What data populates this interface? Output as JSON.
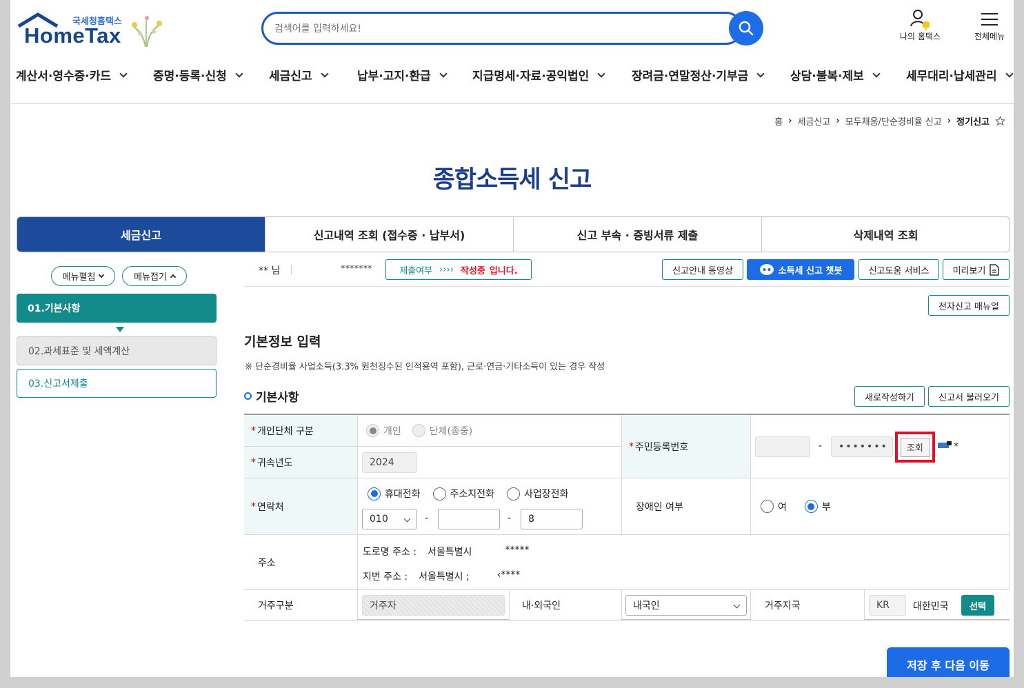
{
  "header": {
    "logo_sub": "국세청홈택스",
    "logo_brand": "HomeTax",
    "search_placeholder": "검색어를 입력하세요!",
    "my_hometax": "나의 홈택스",
    "all_menu": "전체메뉴"
  },
  "gnb": [
    "계산서·영수증·카드",
    "증명·등록·신청",
    "세금신고",
    "납부·고지·환급",
    "지급명세·자료·공익법인",
    "장려금·연말정산·기부금",
    "상담·불복·제보",
    "세무대리·납세관리"
  ],
  "breadcrumb": {
    "home": "홈",
    "c1": "세금신고",
    "c2": "모두채움/단순경비율 신고",
    "current": "정기신고"
  },
  "page_title": "종합소득세 신고",
  "tabs": [
    "세금신고",
    "신고내역 조회 (접수증 · 납부서)",
    "신고 부속 · 증빙서류 제출",
    "삭제내역 조회"
  ],
  "left_menu": {
    "expand": "메뉴펼침",
    "collapse": "메뉴접기",
    "steps": [
      "01.기본사항",
      "02.과세표준 및 세액계산",
      "03.신고서제출"
    ]
  },
  "status": {
    "user": "** 님",
    "masked": "*******",
    "submit_label": "제출여부",
    "arrows": "››››",
    "state": "작성중",
    "state_suffix": "입니다.",
    "btn_video": "신고안내 동영상",
    "btn_chatbot": "소득세 신고 챗봇",
    "btn_help": "신고도움 서비스",
    "btn_preview": "미리보기",
    "btn_manual": "전자신고 매뉴얼"
  },
  "section": {
    "title": "기본정보 입력",
    "note": "※ 단순경비율 사업소득(3.3% 원천징수된 인적용역 포함), 근로·연금·기타소득이 있는 경우 작성",
    "sub": "기본사항",
    "btn_new": "새로작성하기",
    "btn_load": "신고서 불러오기"
  },
  "form": {
    "type_label": "개인단체 구분",
    "type_opt1": "개인",
    "type_opt2": "단체(종중)",
    "year_label": "귀속년도",
    "year_value": "2024",
    "rrn_label": "주민등록번호",
    "rrn_back": "•••••••",
    "rrn_dash": "-",
    "lookup": "조회",
    "star": "*",
    "contact_label": "연락처",
    "contact_opt1": "휴대전화",
    "contact_opt2": "주소지전화",
    "contact_opt3": "사업장전화",
    "phone_prefix": "010",
    "phone_dash": "-",
    "phone_last": "8",
    "disabled_label": "장애인 여부",
    "disabled_yes": "여",
    "disabled_no": "부",
    "address_label": "주소",
    "road_label": "도로명 주소 :",
    "road_value": "서울특별시",
    "road_masked": "*****",
    "jibun_label": "지번 주소 :",
    "jibun_value": "서울특별시 ;",
    "jibun_masked": "‹****",
    "residence_label": "거주구분",
    "residence_value": "거주자",
    "nation_label": "내·외국인",
    "nation_value": "내국인",
    "country_label": "거주지국",
    "country_code": "KR",
    "country_name": "대한민국",
    "country_select": "선택"
  },
  "save_next": "저장 후 다음 이동",
  "colors": {
    "brand_blue": "#1c4b9c",
    "teal": "#138b8b",
    "accent_blue": "#1c6ce6",
    "alert_red": "#e0102a"
  }
}
